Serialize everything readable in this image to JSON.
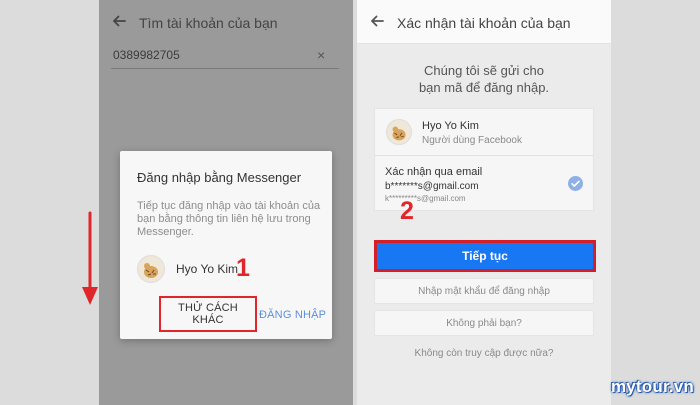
{
  "left_screen": {
    "header": {
      "title": "Tìm tài khoản của bạn"
    },
    "phone_field": {
      "value": "0389982705",
      "clear_glyph": "×"
    },
    "dialog": {
      "title": "Đăng nhập bằng Messenger",
      "body": "Tiếp tục đăng nhập vào tài khoản của bạn bằng thông tin liên hệ lưu trong Messenger.",
      "account_name": "Hyo Yo Kim",
      "try_other_label": "THỬ CÁCH KHÁC",
      "login_label": "ĐĂNG NHẬP"
    },
    "step_label": "1"
  },
  "right_screen": {
    "header": {
      "title": "Xác nhận tài khoản của bạn"
    },
    "message": "Chúng tôi sẽ gửi cho bạn mã để đăng nhập.",
    "account": {
      "name": "Hyo Yo Kim",
      "subtitle": "Người dùng Facebook",
      "option_label": "Xác nhận qua email",
      "email": "b*******s@gmail.com",
      "email_secondary": "k*********s@gmail.com",
      "selected": true
    },
    "step_label": "2",
    "continue_label": "Tiếp tục",
    "password_label": "Nhập mật khẩu để đăng nhập",
    "not_you_label": "Không phải bạn?",
    "no_access_link": "Không còn truy cập được nữa?"
  },
  "brand": "mytour.vn",
  "colors": {
    "left_background": "#9a9a9a",
    "right_background": "#ebebeb",
    "annotation_red": "#e0262a",
    "facebook_blue": "#1877f2",
    "link_blue": "#5b8fd8",
    "check_blue": "#8fb0e6",
    "brand_outline": "#2a5db0"
  },
  "icons": {
    "back": "arrow-left-icon",
    "clear": "close-icon",
    "check": "check-circle-icon",
    "avatar": "tiger-avatar-icon",
    "annotation_arrow": "arrow-down-icon"
  }
}
